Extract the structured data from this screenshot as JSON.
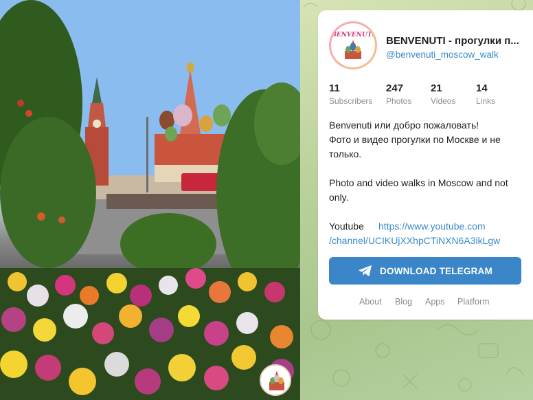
{
  "channel": {
    "name": "BENVENUTI - прогулки п...",
    "handle": "@benvenuti_moscow_walk",
    "avatar_text": "BENVENUTI"
  },
  "stats": [
    {
      "value": "11",
      "label": "Subscribers"
    },
    {
      "value": "247",
      "label": "Photos"
    },
    {
      "value": "21",
      "label": "Videos"
    },
    {
      "value": "14",
      "label": "Links"
    }
  ],
  "description": {
    "line1": "Benvenuti или добро пожаловать!",
    "line2": "Фото и видео прогулки по Москве и не",
    "line3": "только.",
    "line4": "Photo and video walks in Moscow and not",
    "line5": "only.",
    "youtube_label": "Youtube",
    "youtube_url_part1": "https://www.youtube.com",
    "youtube_url_part2": "/channel/UCIKUjXXhpCTiNXN6A3ikLgw"
  },
  "download_button": {
    "label": "DOWNLOAD TELEGRAM",
    "icon": "telegram-plane-icon"
  },
  "footer": [
    "About",
    "Blog",
    "Apps",
    "Platform"
  ],
  "colors": {
    "accent": "#3a86c8",
    "link": "#3a8bc9",
    "background": "#b9d09a"
  }
}
